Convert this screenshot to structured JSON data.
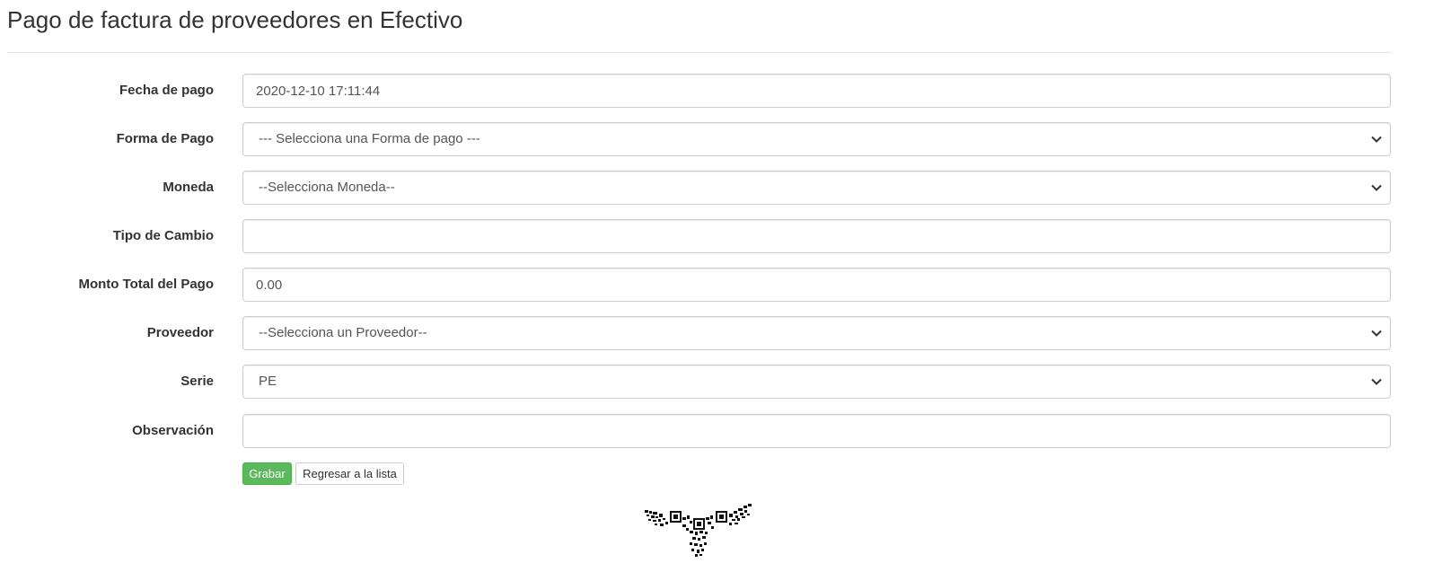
{
  "page": {
    "title": "Pago de factura de proveedores en Efectivo"
  },
  "form": {
    "fecha_pago": {
      "label": "Fecha de pago",
      "value": "2020-12-10 17:11:44"
    },
    "forma_pago": {
      "label": "Forma de Pago",
      "selected": "--- Selecciona una Forma de pago ---"
    },
    "moneda": {
      "label": "Moneda",
      "selected": "--Selecciona Moneda--"
    },
    "tipo_cambio": {
      "label": "Tipo de Cambio",
      "value": ""
    },
    "monto_total": {
      "label": "Monto Total del Pago",
      "value": "0.00"
    },
    "proveedor": {
      "label": "Proveedor",
      "selected": "--Selecciona un Proveedor--"
    },
    "serie": {
      "label": "Serie",
      "selected": "PE"
    },
    "observacion": {
      "label": "Observación",
      "value": ""
    }
  },
  "actions": {
    "save_label": "Grabar",
    "back_label": "Regresar a la lista"
  },
  "colors": {
    "primary_button": "#5cb85c",
    "title_text": "#333333",
    "input_border": "#cccccc"
  },
  "icons": {
    "select_arrow": "chevron-down-icon",
    "footer_logo": "qr-eagle-logo"
  }
}
